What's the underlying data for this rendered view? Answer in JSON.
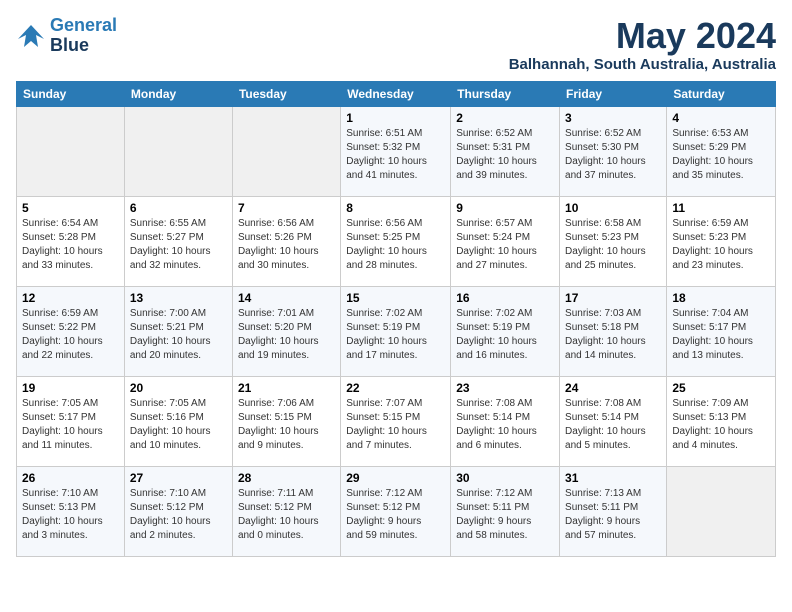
{
  "logo": {
    "line1": "General",
    "line2": "Blue"
  },
  "title": "May 2024",
  "location": "Balhannah, South Australia, Australia",
  "days_of_week": [
    "Sunday",
    "Monday",
    "Tuesday",
    "Wednesday",
    "Thursday",
    "Friday",
    "Saturday"
  ],
  "weeks": [
    [
      {
        "day": "",
        "info": ""
      },
      {
        "day": "",
        "info": ""
      },
      {
        "day": "",
        "info": ""
      },
      {
        "day": "1",
        "info": "Sunrise: 6:51 AM\nSunset: 5:32 PM\nDaylight: 10 hours\nand 41 minutes."
      },
      {
        "day": "2",
        "info": "Sunrise: 6:52 AM\nSunset: 5:31 PM\nDaylight: 10 hours\nand 39 minutes."
      },
      {
        "day": "3",
        "info": "Sunrise: 6:52 AM\nSunset: 5:30 PM\nDaylight: 10 hours\nand 37 minutes."
      },
      {
        "day": "4",
        "info": "Sunrise: 6:53 AM\nSunset: 5:29 PM\nDaylight: 10 hours\nand 35 minutes."
      }
    ],
    [
      {
        "day": "5",
        "info": "Sunrise: 6:54 AM\nSunset: 5:28 PM\nDaylight: 10 hours\nand 33 minutes."
      },
      {
        "day": "6",
        "info": "Sunrise: 6:55 AM\nSunset: 5:27 PM\nDaylight: 10 hours\nand 32 minutes."
      },
      {
        "day": "7",
        "info": "Sunrise: 6:56 AM\nSunset: 5:26 PM\nDaylight: 10 hours\nand 30 minutes."
      },
      {
        "day": "8",
        "info": "Sunrise: 6:56 AM\nSunset: 5:25 PM\nDaylight: 10 hours\nand 28 minutes."
      },
      {
        "day": "9",
        "info": "Sunrise: 6:57 AM\nSunset: 5:24 PM\nDaylight: 10 hours\nand 27 minutes."
      },
      {
        "day": "10",
        "info": "Sunrise: 6:58 AM\nSunset: 5:23 PM\nDaylight: 10 hours\nand 25 minutes."
      },
      {
        "day": "11",
        "info": "Sunrise: 6:59 AM\nSunset: 5:23 PM\nDaylight: 10 hours\nand 23 minutes."
      }
    ],
    [
      {
        "day": "12",
        "info": "Sunrise: 6:59 AM\nSunset: 5:22 PM\nDaylight: 10 hours\nand 22 minutes."
      },
      {
        "day": "13",
        "info": "Sunrise: 7:00 AM\nSunset: 5:21 PM\nDaylight: 10 hours\nand 20 minutes."
      },
      {
        "day": "14",
        "info": "Sunrise: 7:01 AM\nSunset: 5:20 PM\nDaylight: 10 hours\nand 19 minutes."
      },
      {
        "day": "15",
        "info": "Sunrise: 7:02 AM\nSunset: 5:19 PM\nDaylight: 10 hours\nand 17 minutes."
      },
      {
        "day": "16",
        "info": "Sunrise: 7:02 AM\nSunset: 5:19 PM\nDaylight: 10 hours\nand 16 minutes."
      },
      {
        "day": "17",
        "info": "Sunrise: 7:03 AM\nSunset: 5:18 PM\nDaylight: 10 hours\nand 14 minutes."
      },
      {
        "day": "18",
        "info": "Sunrise: 7:04 AM\nSunset: 5:17 PM\nDaylight: 10 hours\nand 13 minutes."
      }
    ],
    [
      {
        "day": "19",
        "info": "Sunrise: 7:05 AM\nSunset: 5:17 PM\nDaylight: 10 hours\nand 11 minutes."
      },
      {
        "day": "20",
        "info": "Sunrise: 7:05 AM\nSunset: 5:16 PM\nDaylight: 10 hours\nand 10 minutes."
      },
      {
        "day": "21",
        "info": "Sunrise: 7:06 AM\nSunset: 5:15 PM\nDaylight: 10 hours\nand 9 minutes."
      },
      {
        "day": "22",
        "info": "Sunrise: 7:07 AM\nSunset: 5:15 PM\nDaylight: 10 hours\nand 7 minutes."
      },
      {
        "day": "23",
        "info": "Sunrise: 7:08 AM\nSunset: 5:14 PM\nDaylight: 10 hours\nand 6 minutes."
      },
      {
        "day": "24",
        "info": "Sunrise: 7:08 AM\nSunset: 5:14 PM\nDaylight: 10 hours\nand 5 minutes."
      },
      {
        "day": "25",
        "info": "Sunrise: 7:09 AM\nSunset: 5:13 PM\nDaylight: 10 hours\nand 4 minutes."
      }
    ],
    [
      {
        "day": "26",
        "info": "Sunrise: 7:10 AM\nSunset: 5:13 PM\nDaylight: 10 hours\nand 3 minutes."
      },
      {
        "day": "27",
        "info": "Sunrise: 7:10 AM\nSunset: 5:12 PM\nDaylight: 10 hours\nand 2 minutes."
      },
      {
        "day": "28",
        "info": "Sunrise: 7:11 AM\nSunset: 5:12 PM\nDaylight: 10 hours\nand 0 minutes."
      },
      {
        "day": "29",
        "info": "Sunrise: 7:12 AM\nSunset: 5:12 PM\nDaylight: 9 hours\nand 59 minutes."
      },
      {
        "day": "30",
        "info": "Sunrise: 7:12 AM\nSunset: 5:11 PM\nDaylight: 9 hours\nand 58 minutes."
      },
      {
        "day": "31",
        "info": "Sunrise: 7:13 AM\nSunset: 5:11 PM\nDaylight: 9 hours\nand 57 minutes."
      },
      {
        "day": "",
        "info": ""
      }
    ]
  ]
}
